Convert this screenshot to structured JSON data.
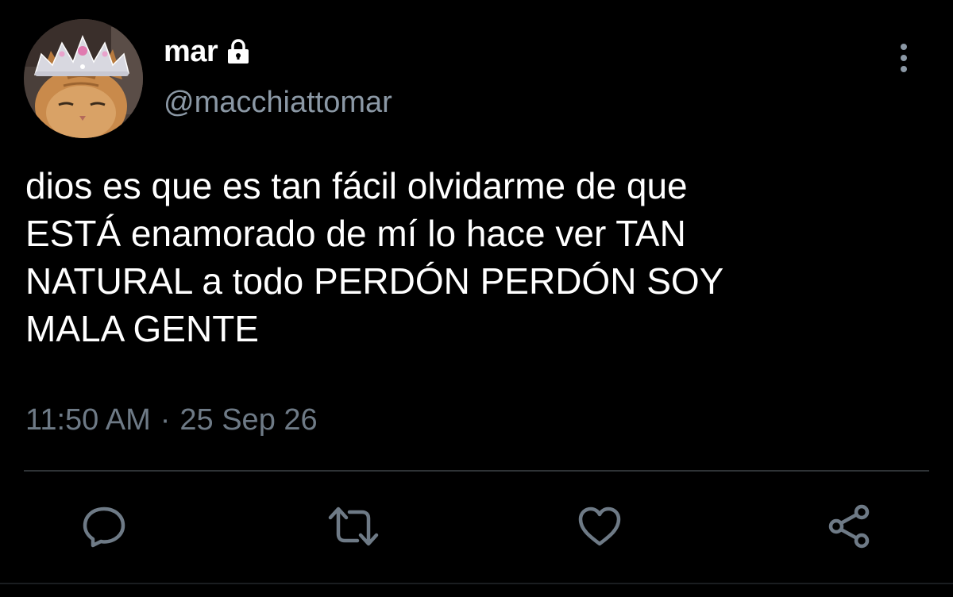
{
  "user": {
    "display_name": "mar",
    "handle": "@macchiattomar",
    "protected": true
  },
  "tweet": {
    "text": "dios es que es tan fácil olvidarme de que\nESTÁ enamorado de mí lo hace ver TAN\nNATURAL a todo PERDÓN PERDÓN SOY\nMALA GENTE",
    "time": "11:50 AM",
    "separator": "·",
    "date": "25 Sep 26"
  },
  "actions": [
    {
      "name": "reply",
      "icon": "reply-icon"
    },
    {
      "name": "retweet",
      "icon": "retweet-icon"
    },
    {
      "name": "like",
      "icon": "heart-icon"
    },
    {
      "name": "share",
      "icon": "share-icon"
    }
  ],
  "colors": {
    "background": "#000000",
    "text": "#ffffff",
    "secondary_text": "#8b98a5",
    "icon": "#6e7a86",
    "divider": "#2f3336"
  }
}
